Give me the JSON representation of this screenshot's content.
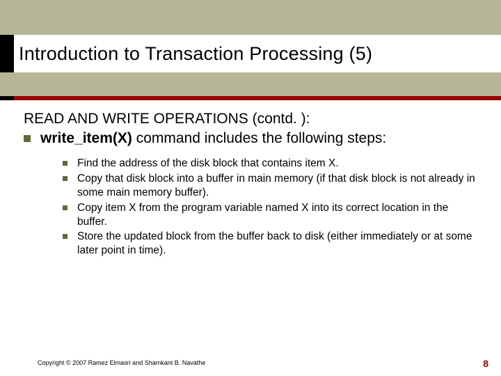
{
  "title": "Introduction to Transaction Processing (5)",
  "lead": "READ AND WRITE OPERATIONS (contd. ):",
  "bullet1_prefix": "write_item(X)",
  "bullet1_rest": " command includes the following steps:",
  "sub_bullets": {
    "0": "Find the address of the disk block that contains item X.",
    "1": "Copy that disk block into a buffer in main memory (if that disk block is not already in some main memory buffer).",
    "2": "Copy item X from the program variable named X into its correct location in the buffer.",
    "3": "Store the updated block from the buffer back to disk (either immediately or at some later point in time)."
  },
  "copyright": "Copyright © 2007 Ramez Elmasri and Shamkant B. Navathe",
  "page_number": "8"
}
